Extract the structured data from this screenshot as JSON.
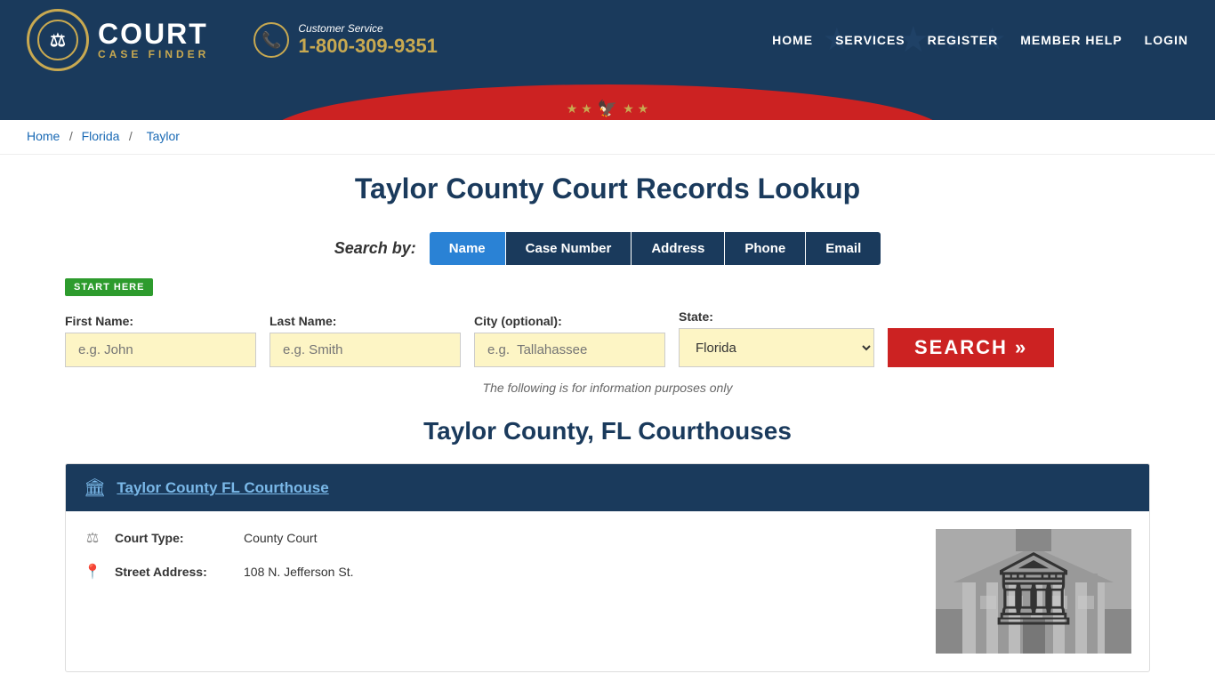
{
  "header": {
    "logo_court": "COURT",
    "logo_case_finder": "CASE FINDER",
    "customer_service_label": "Customer Service",
    "phone": "1-800-309-9351",
    "nav": [
      {
        "label": "HOME",
        "id": "home"
      },
      {
        "label": "SERVICES",
        "id": "services"
      },
      {
        "label": "REGISTER",
        "id": "register"
      },
      {
        "label": "MEMBER HELP",
        "id": "member-help"
      },
      {
        "label": "LOGIN",
        "id": "login"
      }
    ],
    "eagle_stars_left": "★ ★",
    "eagle_symbol": "🦅",
    "eagle_stars_right": "★ ★"
  },
  "breadcrumb": {
    "home": "Home",
    "state": "Florida",
    "county": "Taylor"
  },
  "page": {
    "title": "Taylor County Court Records Lookup",
    "search_by_label": "Search by:",
    "search_tabs": [
      {
        "label": "Name",
        "id": "name",
        "active": true
      },
      {
        "label": "Case Number",
        "id": "case-number",
        "active": false
      },
      {
        "label": "Address",
        "id": "address",
        "active": false
      },
      {
        "label": "Phone",
        "id": "phone",
        "active": false
      },
      {
        "label": "Email",
        "id": "email",
        "active": false
      }
    ],
    "start_here_badge": "START HERE",
    "form": {
      "first_name_label": "First Name:",
      "first_name_placeholder": "e.g. John",
      "last_name_label": "Last Name:",
      "last_name_placeholder": "e.g. Smith",
      "city_label": "City (optional):",
      "city_placeholder": "e.g.  Tallahassee",
      "state_label": "State:",
      "state_value": "Florida",
      "search_button": "SEARCH »"
    },
    "info_note": "The following is for information purposes only",
    "courthouses_title": "Taylor County, FL Courthouses",
    "courthouse": {
      "name": "Taylor County FL Courthouse",
      "court_type_label": "Court Type:",
      "court_type_value": "County Court",
      "street_address_label": "Street Address:",
      "street_address_value": "108 N. Jefferson St."
    }
  }
}
